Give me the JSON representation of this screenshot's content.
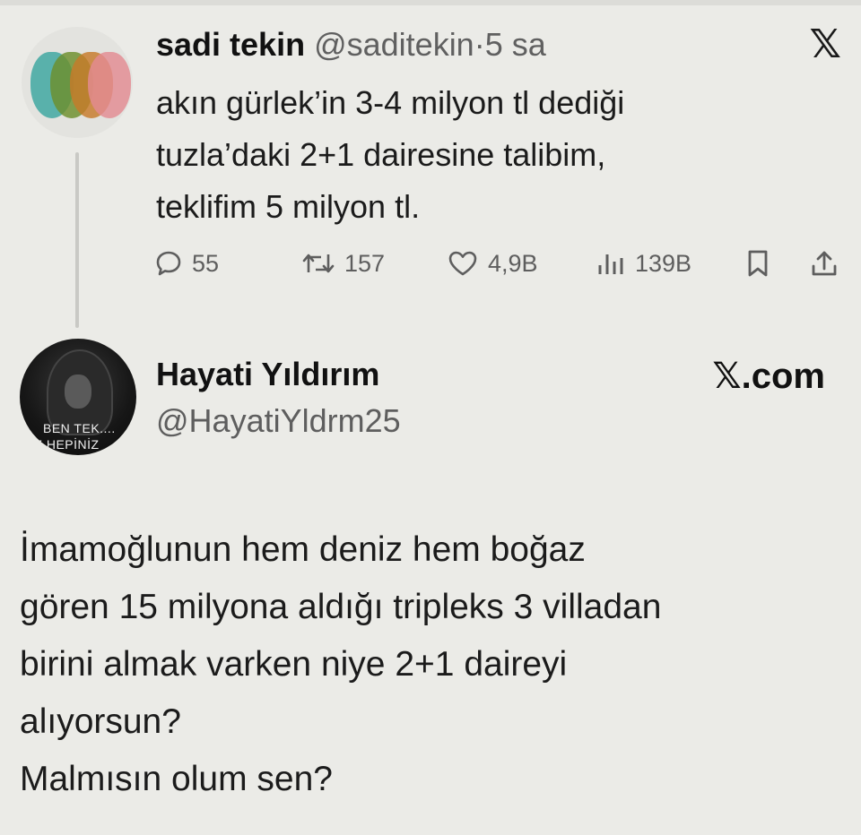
{
  "quoted_tweet": {
    "author_name": "sadi tekin",
    "author_handle": "@saditekin",
    "separator": "·",
    "time": "5 sa",
    "x_logo": "𝕏",
    "text_lines": [
      "akın gürlek’in 3-4 milyon tl dediği",
      "tuzla’daki 2+1 dairesine talibim,",
      "teklifim 5 milyon tl."
    ],
    "actions": {
      "replies": "55",
      "reposts": "157",
      "likes": "4,9B",
      "views": "139B"
    },
    "icons": [
      "reply-icon",
      "repost-icon",
      "like-icon",
      "views-icon",
      "bookmark-icon",
      "share-icon"
    ]
  },
  "main_tweet": {
    "author_name": "Hayati Yıldırım",
    "author_handle": "@HayatiYldrm25",
    "avatar_text": [
      "BEN TEK....",
      "İZ HEPİNİZ"
    ],
    "watermark_logo": "𝕏",
    "watermark_suffix": ".com",
    "text_lines": [
      "İmamoğlunun hem deniz hem boğaz",
      "gören 15 milyona aldığı tripleks 3 villadan",
      "birini almak varken niye 2+1 daireyi",
      "alıyorsun?",
      "Malmısın olum sen?"
    ]
  },
  "colors": {
    "background": "#ebebe7",
    "text": "#1b1b1b",
    "muted": "#5e5e5e"
  }
}
